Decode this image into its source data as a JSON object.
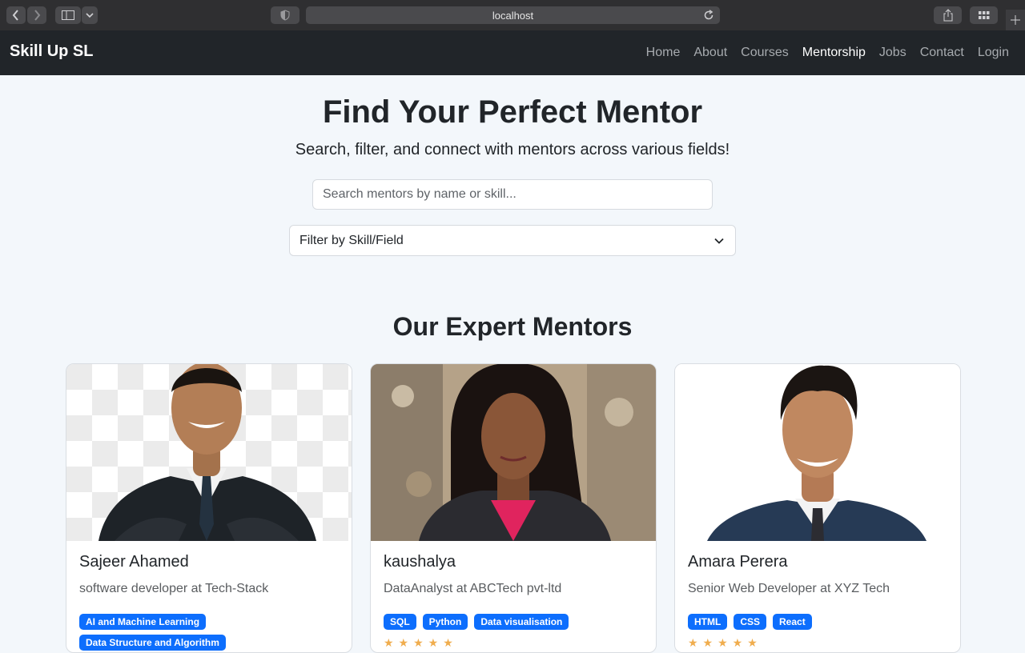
{
  "browser": {
    "url": "localhost"
  },
  "navbar": {
    "brand": "Skill Up SL",
    "links": [
      "Home",
      "About",
      "Courses",
      "Mentorship",
      "Jobs",
      "Contact",
      "Login"
    ],
    "active": "Mentorship"
  },
  "hero": {
    "title": "Find Your Perfect Mentor",
    "subtitle": "Search, filter, and connect with mentors across various fields!",
    "search_placeholder": "Search mentors by name or skill...",
    "filter_label": "Filter by Skill/Field"
  },
  "section": {
    "title": "Our Expert Mentors"
  },
  "mentors": [
    {
      "name": "Sajeer Ahamed",
      "role": "software developer at Tech-Stack",
      "skills": [
        "AI and Machine Learning",
        "Data Structure and Algorithm"
      ],
      "rating": "★★★★★"
    },
    {
      "name": "kaushalya",
      "role": "DataAnalyst at ABCTech pvt-ltd",
      "skills": [
        "SQL",
        "Python",
        "Data visualisation"
      ],
      "rating": "★★★★★"
    },
    {
      "name": "Amara Perera",
      "role": "Senior Web Developer at XYZ Tech",
      "skills": [
        "HTML",
        "CSS",
        "React"
      ],
      "rating": "★★★★★"
    }
  ],
  "colors": {
    "navbar": "#212529",
    "accent": "#0d6efd",
    "background": "#f3f7fb"
  }
}
